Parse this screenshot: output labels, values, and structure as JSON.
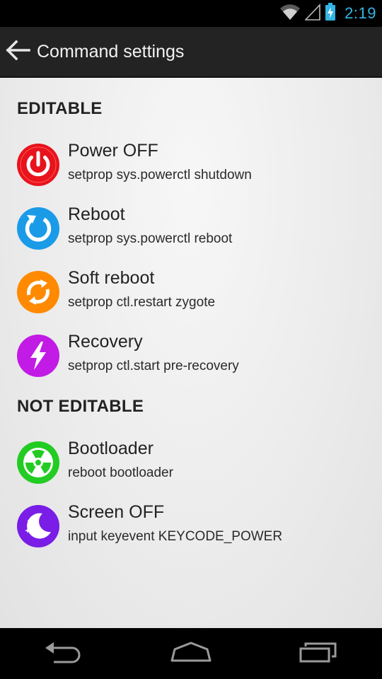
{
  "status_bar": {
    "time": "2:19",
    "icons": [
      "wifi-icon",
      "signal-icon",
      "battery-charging-icon"
    ]
  },
  "action_bar": {
    "title": "Command settings",
    "back_icon": "back-arrow-icon"
  },
  "sections": [
    {
      "header": "EDITABLE",
      "items": [
        {
          "title": "Power OFF",
          "command": "setprop sys.powerctl shutdown",
          "icon": "power-icon",
          "color": "#e8131c"
        },
        {
          "title": "Reboot",
          "command": "setprop sys.powerctl reboot",
          "icon": "reboot-icon",
          "color": "#1a9be8"
        },
        {
          "title": "Soft reboot",
          "command": "setprop ctl.restart zygote",
          "icon": "soft-reboot-icon",
          "color": "#ff8a00"
        },
        {
          "title": "Recovery",
          "command": "setprop ctl.start pre-recovery",
          "icon": "recovery-bolt-icon",
          "color": "#c21be6"
        }
      ]
    },
    {
      "header": "NOT EDITABLE",
      "items": [
        {
          "title": "Bootloader",
          "command": "reboot bootloader",
          "icon": "bootloader-radiation-icon",
          "color": "#22cc22"
        },
        {
          "title": "Screen OFF",
          "command": "input keyevent KEYCODE_POWER",
          "icon": "screen-off-moon-icon",
          "color": "#7a1de6"
        }
      ]
    }
  ],
  "nav_bar": {
    "buttons": [
      "back-nav-icon",
      "home-nav-icon",
      "recents-nav-icon"
    ]
  }
}
